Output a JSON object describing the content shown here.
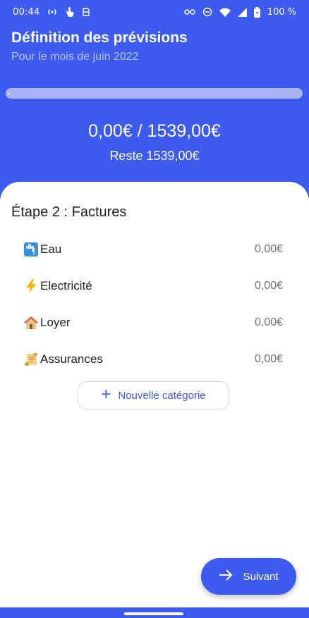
{
  "status_bar": {
    "time": "00:44",
    "battery": "100 %"
  },
  "header": {
    "title": "Définition des prévisions",
    "subtitle": "Pour le mois de juin 2022"
  },
  "progress": {
    "fraction": 0.0
  },
  "summary": {
    "amount": "0,00€ / 1539,00€",
    "remaining": "Reste 1539,00€"
  },
  "step": {
    "title": "Étape 2 : Factures"
  },
  "categories": [
    {
      "emoji": "water-faucet-icon",
      "label": "Eau",
      "amount": "0,00€"
    },
    {
      "emoji": "lightning-icon",
      "label": "Electricité",
      "amount": "0,00€"
    },
    {
      "emoji": "house-icon",
      "label": "Loyer",
      "amount": "0,00€"
    },
    {
      "emoji": "scroll-icon",
      "label": "Assurances",
      "amount": "0,00€"
    }
  ],
  "buttons": {
    "new_category": "Nouvelle catégorie",
    "next": "Suivant"
  },
  "colors": {
    "primary": "#3d5af1",
    "progress_track": "#a9b2f5",
    "subtitle": "#b9c2fb"
  }
}
